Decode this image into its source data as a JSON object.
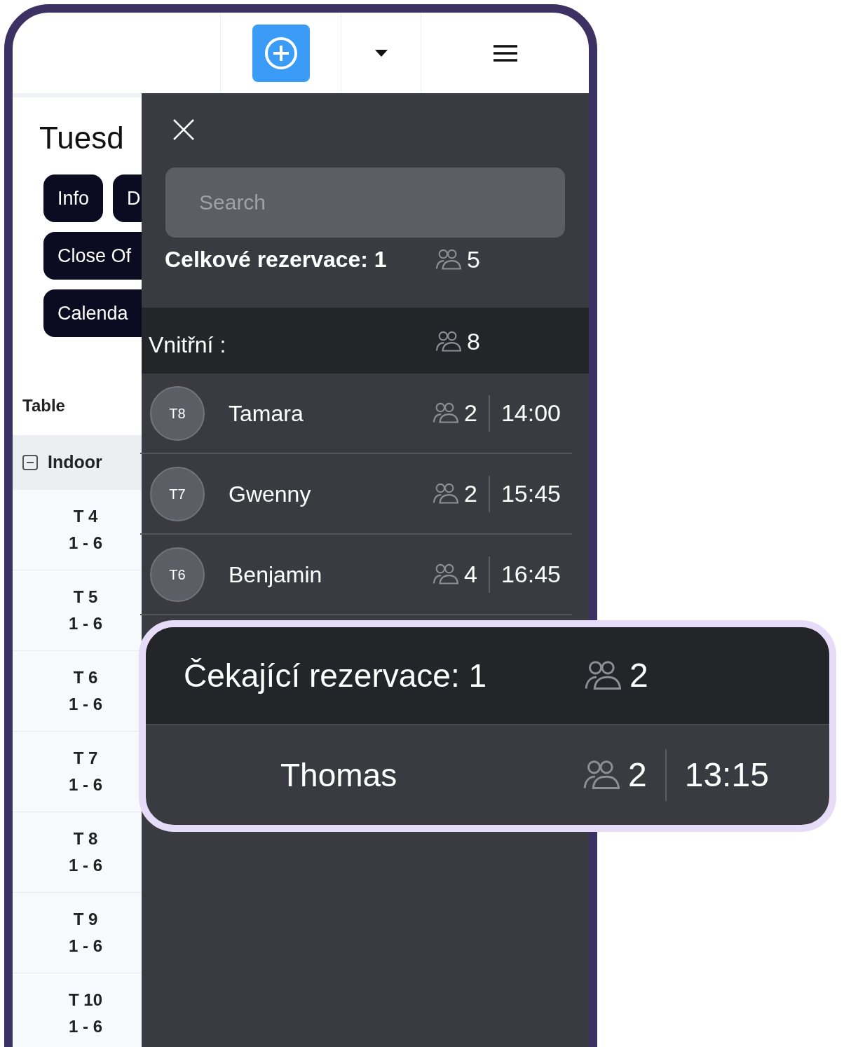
{
  "left_panel": {
    "day_title": "Tuesd",
    "buttons": [
      "Info",
      "D",
      "Close Of",
      "Calenda"
    ],
    "table_header": "Table",
    "group": {
      "label": "Indoor",
      "expanded": true
    },
    "tables": [
      {
        "name": "T 4",
        "capacity": "1 - 6"
      },
      {
        "name": "T 5",
        "capacity": "1 - 6"
      },
      {
        "name": "T 6",
        "capacity": "1 - 6"
      },
      {
        "name": "T 7",
        "capacity": "1 - 6"
      },
      {
        "name": "T 8",
        "capacity": "1 - 6"
      },
      {
        "name": "T 9",
        "capacity": "1 - 6"
      },
      {
        "name": "T 10",
        "capacity": "1 - 6"
      }
    ]
  },
  "drawer": {
    "search": {
      "placeholder": "Search"
    },
    "total": {
      "label": "Celkové rezervace: 1",
      "guests": "5"
    },
    "section": {
      "label": "Vnitřní :",
      "guests": "8"
    },
    "reservations": [
      {
        "table": "T8",
        "name": "Tamara",
        "guests": "2",
        "time": "14:00"
      },
      {
        "table": "T7",
        "name": "Gwenny",
        "guests": "2",
        "time": "15:45"
      },
      {
        "table": "T6",
        "name": "Benjamin",
        "guests": "4",
        "time": "16:45"
      }
    ]
  },
  "waiting": {
    "label": "Čekající rezervace: 1",
    "guests": "2",
    "reservations": [
      {
        "name": "Thomas",
        "guests": "2",
        "time": "13:15"
      }
    ]
  }
}
